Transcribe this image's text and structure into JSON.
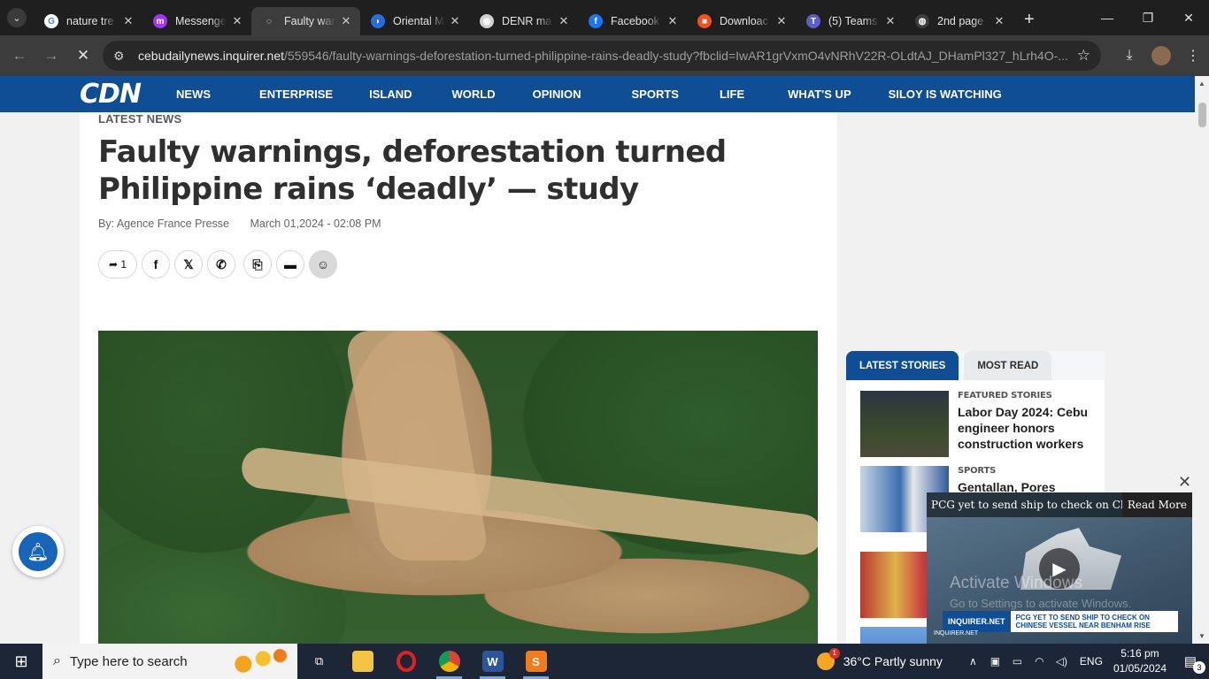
{
  "browser": {
    "tabs": [
      {
        "label": "nature tre",
        "favicon": "google-icon",
        "fav_color": "#ffffff",
        "fav_glyph": "G"
      },
      {
        "label": "Messenge",
        "favicon": "messenger-icon",
        "fav_color": "#a334fa",
        "fav_glyph": "m"
      },
      {
        "label": "Faulty war",
        "favicon": "loading-spinner-icon",
        "fav_color": "#3c3c3c",
        "fav_glyph": "◌",
        "active": true
      },
      {
        "label": "Oriental M",
        "favicon": "copilot-icon",
        "fav_color": "#2b6be0",
        "fav_glyph": "◗"
      },
      {
        "label": "DENR ma",
        "favicon": "denr-seal-icon",
        "fav_color": "#d0d0d0",
        "fav_glyph": "◉"
      },
      {
        "label": "Facebook",
        "favicon": "facebook-icon",
        "fav_color": "#1877f2",
        "fav_glyph": "f"
      },
      {
        "label": "Downloac",
        "favicon": "microsoft-icon",
        "fav_color": "#f25022",
        "fav_glyph": "■"
      },
      {
        "label": "(5) Teams",
        "favicon": "teams-icon",
        "fav_color": "#5b5fc7",
        "fav_glyph": "T"
      },
      {
        "label": "2nd page",
        "favicon": "globe-icon",
        "fav_color": "#3c3c3c",
        "fav_glyph": "◍"
      }
    ],
    "url_host": "cebudailynews.inquirer.net",
    "url_path": "/559546/faulty-warnings-deforestation-turned-philippine-rains-deadly-study?fbclid=IwAR1grVxmO4vNRhV22R-OLdtAJ_DHamPl327_hLrh4O-..."
  },
  "site": {
    "logo": "CDN",
    "nav": [
      "NEWS",
      "ENTERPRISE",
      "ISLAND",
      "WORLD",
      "OPINION",
      "SPORTS",
      "LIFE",
      "WHAT'S UP",
      "SILOY IS WATCHING"
    ],
    "brand_color": "#0f4d95"
  },
  "article": {
    "kicker": "LATEST NEWS",
    "headline": "Faulty warnings, deforestation turned Philippine rains ‘deadly’ — study",
    "author": "By: Agence France Presse",
    "date": "March 01,2024 - 02:08 PM",
    "share_count": "1"
  },
  "sidebar": {
    "tabs": [
      "LATEST STORIES",
      "MOST READ"
    ],
    "stories": [
      {
        "category": "FEATURED STORIES",
        "title": "Labor Day 2024: Cebu engineer honors construction workers"
      },
      {
        "category": "SPORTS",
        "title": "Gentallan, Pores"
      }
    ]
  },
  "video": {
    "title": "PCG yet to send ship to check on Chinese vessel near Benham Rise",
    "read_more": "Read More",
    "watermark_1": "Activate Windows",
    "watermark_2": "Go to Settings to activate Windows.",
    "banner_brand": "INQUIRER.NET",
    "banner_text": "PCG YET TO SEND SHIP TO CHECK ON CHINESE VESSEL NEAR BENHAM RISE",
    "sign": "INQUIRER.NET"
  },
  "taskbar": {
    "search_placeholder": "Type here to search",
    "weather": "36°C  Partly sunny",
    "language": "ENG",
    "time": "5:16 pm",
    "date": "01/05/2024",
    "notifications": "3"
  }
}
